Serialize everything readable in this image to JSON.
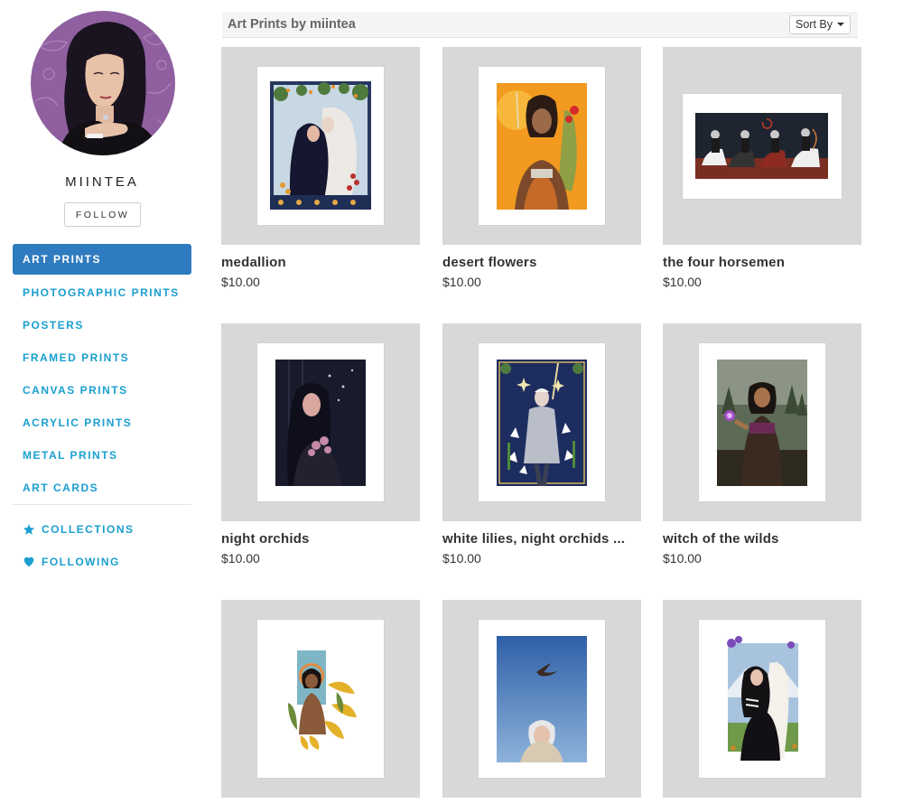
{
  "profile": {
    "username": "MIINTEA",
    "follow_label": "FOLLOW"
  },
  "nav": {
    "items": [
      {
        "label": "ART PRINTS",
        "active": true
      },
      {
        "label": "PHOTOGRAPHIC PRINTS"
      },
      {
        "label": "POSTERS"
      },
      {
        "label": "FRAMED PRINTS"
      },
      {
        "label": "CANVAS PRINTS"
      },
      {
        "label": "ACRYLIC PRINTS"
      },
      {
        "label": "METAL PRINTS"
      },
      {
        "label": "ART CARDS"
      }
    ],
    "secondary": [
      {
        "label": "COLLECTIONS",
        "icon": "star-icon"
      },
      {
        "label": "FOLLOWING",
        "icon": "heart-icon"
      }
    ]
  },
  "header": {
    "title": "Art Prints by miintea",
    "sort_label": "Sort By"
  },
  "products": [
    {
      "title": "medallion",
      "price": "$10.00"
    },
    {
      "title": "desert flowers",
      "price": "$10.00"
    },
    {
      "title": "the four horsemen",
      "price": "$10.00"
    },
    {
      "title": "night orchids",
      "price": "$10.00"
    },
    {
      "title": "white lilies, night orchids ...",
      "price": "$10.00"
    },
    {
      "title": "witch of the wilds",
      "price": "$10.00"
    },
    {
      "title": "",
      "price": ""
    },
    {
      "title": "",
      "price": ""
    },
    {
      "title": "",
      "price": ""
    }
  ],
  "colors": {
    "accent": "#1a9fd0",
    "active_nav_bg": "#2f7bbf",
    "thumb_bg": "#d8d8d8",
    "avatar_bg": "#8f5fa0"
  }
}
